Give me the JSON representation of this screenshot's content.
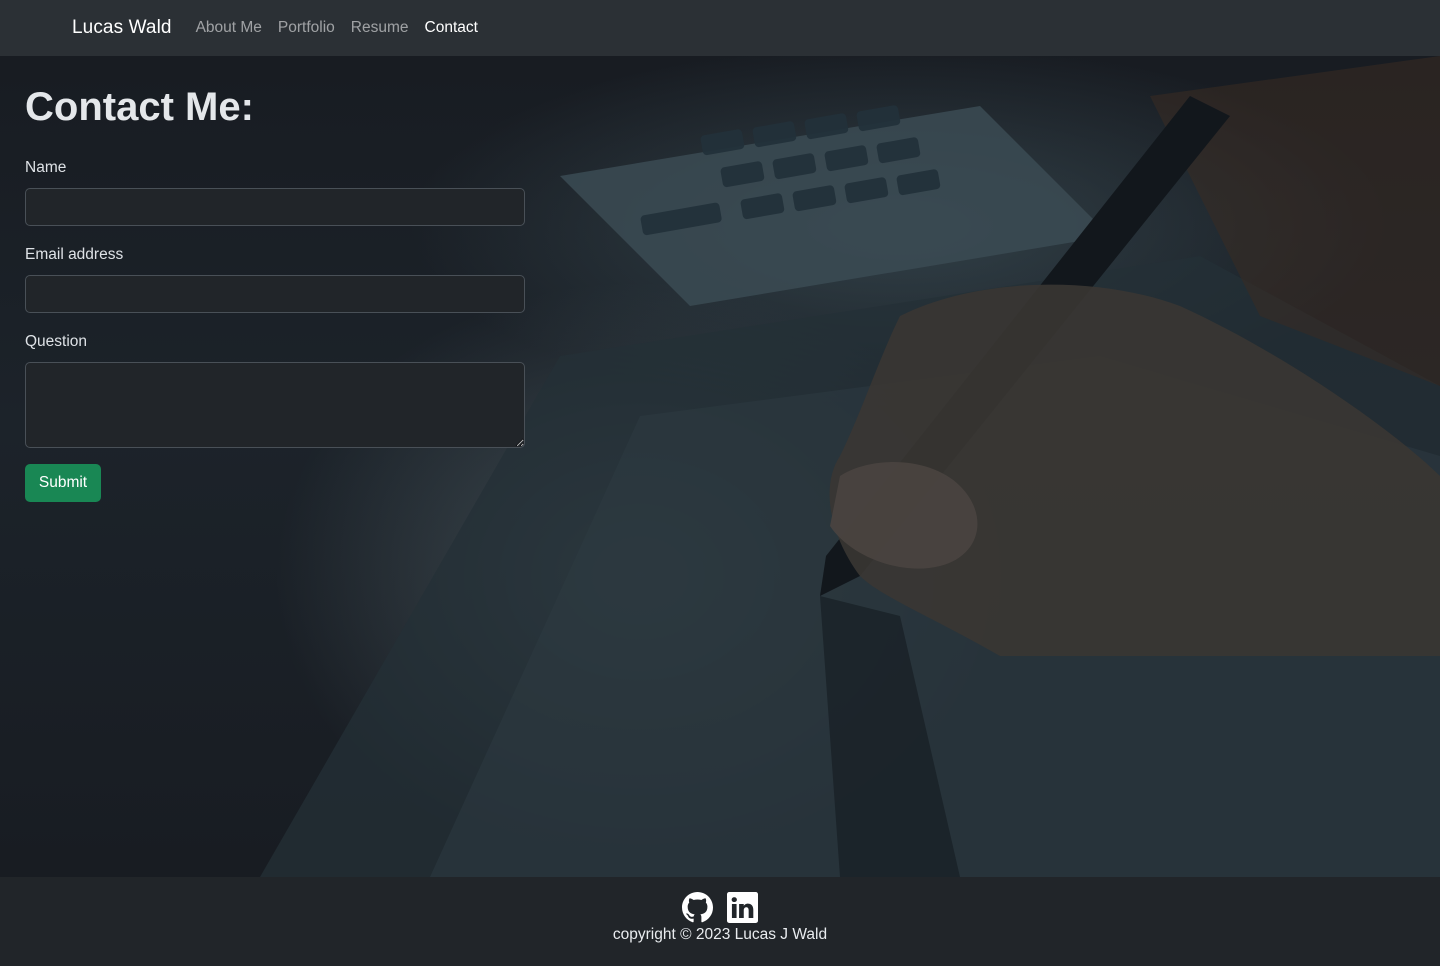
{
  "navbar": {
    "brand": "Lucas Wald",
    "links": [
      {
        "label": "About Me",
        "active": false
      },
      {
        "label": "Portfolio",
        "active": false
      },
      {
        "label": "Resume",
        "active": false
      },
      {
        "label": "Contact",
        "active": true
      }
    ]
  },
  "contact": {
    "heading": "Contact Me:",
    "name_label": "Name",
    "name_value": "",
    "email_label": "Email address",
    "email_value": "",
    "question_label": "Question",
    "question_value": "",
    "submit_label": "Submit"
  },
  "background": {
    "subject": "hand holding a stylus over a drawing tablet near a keyboard"
  },
  "footer": {
    "icons": [
      "github-icon",
      "linkedin-icon"
    ],
    "copyright": "copyright © 2023 Lucas J Wald"
  },
  "colors": {
    "navbar_bg": "#2b3035",
    "page_bg": "#1b1f25",
    "input_bg": "#212529",
    "submit_bg": "#198754",
    "footer_bg": "#212529"
  }
}
